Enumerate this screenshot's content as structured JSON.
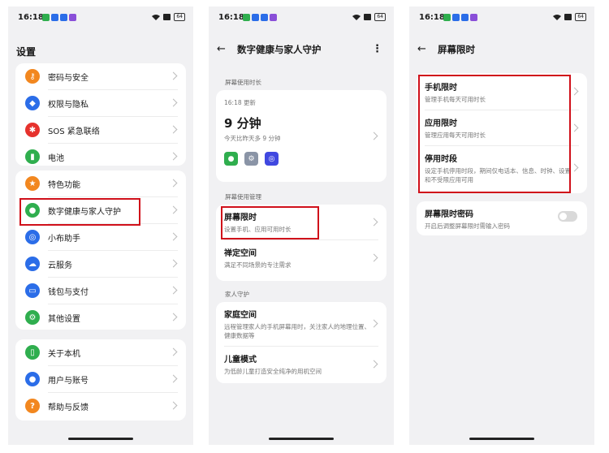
{
  "status": {
    "time": "16:18",
    "battery": "64"
  },
  "settings": {
    "title": "设置",
    "group1": [
      {
        "label": "密码与安全",
        "icon": "key-icon",
        "color": "#f2871f",
        "glyph": "⚷"
      },
      {
        "label": "权限与隐私",
        "icon": "shield-icon",
        "color": "#2b6de8",
        "glyph": "◆"
      },
      {
        "label": "SOS 紧急联络",
        "icon": "sos-icon",
        "color": "#e6322d",
        "glyph": "✱"
      },
      {
        "label": "电池",
        "icon": "battery-icon",
        "color": "#2fae4e",
        "glyph": "▮"
      }
    ],
    "group2": [
      {
        "label": "特色功能",
        "icon": "star-icon",
        "color": "#f2871f",
        "glyph": "★"
      },
      {
        "label": "数字健康与家人守护",
        "icon": "person-icon",
        "color": "#2fae4e",
        "glyph": "●"
      },
      {
        "label": "小布助手",
        "icon": "assistant-icon",
        "color": "#2b6de8",
        "glyph": "◎"
      },
      {
        "label": "云服务",
        "icon": "cloud-icon",
        "color": "#2b6de8",
        "glyph": "☁"
      },
      {
        "label": "钱包与支付",
        "icon": "wallet-icon",
        "color": "#2b6de8",
        "glyph": "▭"
      },
      {
        "label": "其他设置",
        "icon": "gear-icon",
        "color": "#2fae4e",
        "glyph": "⚙"
      }
    ],
    "group3": [
      {
        "label": "关于本机",
        "icon": "phone-icon",
        "color": "#2fae4e",
        "glyph": "▯"
      },
      {
        "label": "用户与账号",
        "icon": "user-icon",
        "color": "#2b6de8",
        "glyph": "●"
      },
      {
        "label": "帮助与反馈",
        "icon": "help-icon",
        "color": "#f2871f",
        "glyph": "?"
      }
    ]
  },
  "wellbeing": {
    "title": "数字健康与家人守护",
    "section_usage": "屏幕使用时长",
    "updated": "16:18 更新",
    "usage": "9 分钟",
    "compare": "今天比昨天多 9 分钟",
    "section_manage": "屏幕使用管理",
    "screen_limit_title": "屏幕限时",
    "screen_limit_sub": "设置手机、应用可用时长",
    "focus_title": "禅定空间",
    "focus_sub": "满足不同场景的专注需求",
    "section_family": "家人守护",
    "family_title": "家庭空间",
    "family_sub": "远程管理家人的手机屏幕用时，关注家人的地理位置、健康数据等",
    "kids_title": "儿童模式",
    "kids_sub": "为低龄儿童打造安全纯净的用机空间"
  },
  "screentime": {
    "title": "屏幕限时",
    "phone_title": "手机限时",
    "phone_sub": "管理手机每天可用时长",
    "app_title": "应用限时",
    "app_sub": "管理应用每天可用时长",
    "downtime_title": "停用时段",
    "downtime_sub": "设定手机停用时段，期间仅电话本、信息、时钟、设置和不受限应用可用",
    "passcode_title": "屏幕限时密码",
    "passcode_sub": "开启后调整屏幕限时需输入密码",
    "passcode_on": false
  }
}
